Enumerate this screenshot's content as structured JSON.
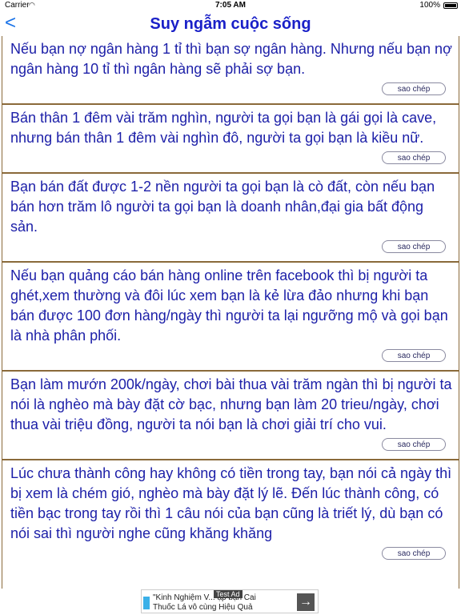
{
  "status": {
    "carrier": "Carrier",
    "time": "7:05 AM",
    "battery": "100%"
  },
  "nav": {
    "back": "<",
    "title": "Suy ngẫm cuộc sống"
  },
  "items": [
    {
      "text": "Nếu bạn nợ ngân hàng 1 tỉ thì bạn sợ ngân hàng. Nhưng nếu bạn nợ ngân hàng 10 tỉ thì ngân hàng sẽ phải sợ bạn.",
      "copy": "sao chép"
    },
    {
      "text": "Bán thân 1 đêm vài trăm nghìn, người ta gọi bạn là gái gọi là cave, nhưng bán thân 1 đêm vài nghìn đô, người ta gọi bạn là kiều nữ.",
      "copy": "sao chép"
    },
    {
      "text": "Bạn bán đất được 1-2 nền người ta gọi bạn là cò đất, còn nếu bạn bán hơn trăm lô người ta gọi bạn là doanh nhân,đại gia bất động sản.",
      "copy": "sao chép"
    },
    {
      "text": "Nếu bạn quảng cáo bán hàng online trên facebook thì bị người ta ghét,xem thường và đôi lúc xem bạn là kẻ lừa đảo nhưng khi bạn bán được 100 đơn hàng/ngày thì người ta lại ngưỡng mộ và gọi bạn là nhà phân phối.",
      "copy": "sao chép"
    },
    {
      "text": "Bạn làm mướn 200k/ngày, chơi bài thua vài trăm ngàn thì bị người ta nói là nghèo mà bày đặt cờ bạc, nhưng bạn làm 20 trieu/ngày, chơi thua vài triệu đồng, người ta nói bạn là chơi giải trí cho vui.",
      "copy": "sao chép"
    },
    {
      "text": "Lúc chưa thành công hay không có tiền trong tay, bạn nói cả ngày thì bị xem là chém gió, nghèo mà bày đặt lý lẽ. Đến lúc thành công, có tiền bạc trong tay rồi thì 1 câu nói của bạn cũng là triết lý, dù bạn có nói sai thì người nghe cũng khăng khăng",
      "copy": "sao chép"
    }
  ],
  "ad": {
    "label": "Test Ad",
    "line1": "\"Kinh Nghiệm V... ạp bạn Cai",
    "line2": "Thuốc Lá vô cùng Hiệu Quả"
  }
}
